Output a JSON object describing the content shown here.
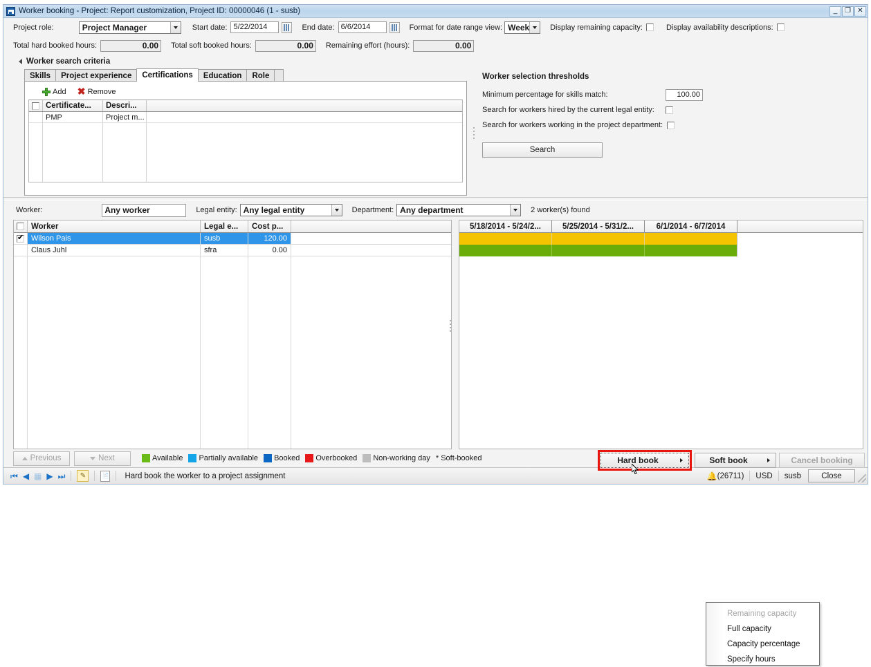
{
  "window": {
    "title": "Worker booking - Project: Report customization, Project ID: 00000046 (1 - susb)",
    "minimize_label": "_",
    "maximize_label": "❐",
    "close_label": "✕"
  },
  "params": {
    "project_role_label": "Project role:",
    "project_role_value": "Project Manager",
    "start_date_label": "Start date:",
    "start_date_value": "5/22/2014",
    "end_date_label": "End date:",
    "end_date_value": "6/6/2014",
    "format_label": "Format for date range view:",
    "format_value": "Weeks",
    "display_remaining_capacity_label": "Display remaining capacity:",
    "display_availability_label": "Display availability descriptions:",
    "total_hard_label": "Total hard booked hours:",
    "total_hard_value": "0.00",
    "total_soft_label": "Total soft booked hours:",
    "total_soft_value": "0.00",
    "remaining_effort_label": "Remaining effort (hours):",
    "remaining_effort_value": "0.00"
  },
  "criteria": {
    "group_title": "Worker search criteria",
    "tabs": [
      {
        "label": "Skills",
        "active": false
      },
      {
        "label": "Project experience",
        "active": false
      },
      {
        "label": "Certifications",
        "active": true
      },
      {
        "label": "Education",
        "active": false
      },
      {
        "label": "Role",
        "active": false
      }
    ],
    "toolbar": {
      "add_label": "Add",
      "remove_label": "Remove"
    },
    "grid": {
      "columns": [
        "Certificate...",
        "Descri..."
      ],
      "rows": [
        {
          "certificate": "PMP",
          "description": "Project m..."
        }
      ]
    }
  },
  "thresholds": {
    "title": "Worker selection thresholds",
    "min_pct_label": "Minimum percentage for skills match:",
    "min_pct_value": "100.00",
    "hired_by_legal_entity_label": "Search for workers hired by the current legal entity:",
    "working_in_dept_label": "Search for workers working in the project department:",
    "search_button": "Search"
  },
  "filters": {
    "worker_label": "Worker:",
    "worker_value": "Any worker",
    "legal_entity_label": "Legal entity:",
    "legal_entity_value": "Any legal entity",
    "department_label": "Department:",
    "department_value": "Any department",
    "found_text": "2 worker(s) found"
  },
  "worker_grid": {
    "columns": [
      "Worker",
      "Legal e...",
      "Cost p..."
    ],
    "rows": [
      {
        "checked": true,
        "selected": true,
        "worker": "Wilson Pais",
        "legal_entity": "susb",
        "cost_price": "120.00"
      },
      {
        "checked": false,
        "selected": false,
        "worker": "Claus Juhl",
        "legal_entity": "sfra",
        "cost_price": "0.00"
      }
    ]
  },
  "calendar": {
    "columns": [
      "5/18/2014 - 5/24/2...",
      "5/25/2014 - 5/31/2...",
      "6/1/2014 - 6/7/2014"
    ],
    "rows": [
      {
        "color": "#f5c400"
      },
      {
        "color": "#6aad09"
      }
    ]
  },
  "popup_menu": {
    "items": [
      {
        "label": "Remaining capacity",
        "disabled": true
      },
      {
        "label": "Full capacity",
        "disabled": false
      },
      {
        "label": "Capacity percentage",
        "disabled": false
      },
      {
        "label": "Specify hours",
        "disabled": false
      }
    ]
  },
  "actionbar": {
    "previous_label": "Previous",
    "next_label": "Next",
    "legend": [
      {
        "label": "Available",
        "color": "#6aba18"
      },
      {
        "label": "Partially available",
        "color": "#14a5e8"
      },
      {
        "label": "Booked",
        "color": "#0a66c2"
      },
      {
        "label": "Overbooked",
        "color": "#e8171a"
      },
      {
        "label": "Non-working day",
        "color": "#bdbdbd"
      }
    ],
    "soft_booked_note": "* Soft-booked",
    "hard_book_label": "Hard book",
    "soft_book_label": "Soft book",
    "cancel_booking_label": "Cancel booking"
  },
  "statusbar": {
    "message": "Hard book the worker to a project assignment",
    "session": "(26711)",
    "currency": "USD",
    "company": "susb",
    "close_label": "Close"
  }
}
